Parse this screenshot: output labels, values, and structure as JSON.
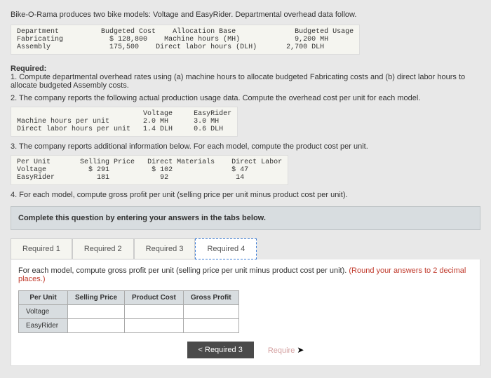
{
  "intro": "Bike-O-Rama produces two bike models: Voltage and EasyRider. Departmental overhead data follow.",
  "table1": {
    "h1": "Department",
    "h2": "Budgeted Cost",
    "h3": "Allocation Base",
    "h4": "Budgeted Usage",
    "r1c1": "Fabricating",
    "r1c2": "$ 128,800",
    "r1c3": "Machine hours (MH)",
    "r1c4": "9,200 MH",
    "r2c1": "Assembly",
    "r2c2": "175,500",
    "r2c3": "Direct labor hours (DLH)",
    "r2c4": "2,700 DLH"
  },
  "required_label": "Required:",
  "req1": "1. Compute departmental overhead rates using (a) machine hours to allocate budgeted Fabricating costs and (b) direct labor hours to allocate budgeted Assembly costs.",
  "req2": "2. The company reports the following actual production usage data. Compute the overhead cost per unit for each model.",
  "table2": {
    "h1": "",
    "h2": "Voltage",
    "h3": "EasyRider",
    "r1c1": "Machine hours per unit",
    "r1c2": "2.0 MH",
    "r1c3": "3.0 MH",
    "r2c1": "Direct labor hours per unit",
    "r2c2": "1.4 DLH",
    "r2c3": "0.6 DLH"
  },
  "req3": "3. The company reports additional information below. For each model, compute the product cost per unit.",
  "table3": {
    "h1": "Per Unit",
    "h2": "Selling Price",
    "h3": "Direct Materials",
    "h4": "Direct Labor",
    "r1c1": "Voltage",
    "r1c2": "$ 291",
    "r1c3": "$ 102",
    "r1c4": "$ 47",
    "r2c1": "EasyRider",
    "r2c2": "181",
    "r2c3": "92",
    "r2c4": "14"
  },
  "req4": "4. For each model, compute gross profit per unit (selling price per unit minus product cost per unit).",
  "instruction": "Complete this question by entering your answers in the tabs below.",
  "tabs": {
    "t1": "Required 1",
    "t2": "Required 2",
    "t3": "Required 3",
    "t4": "Required 4"
  },
  "tab4": {
    "instruction_main": "For each model, compute gross profit per unit (selling price per unit minus product cost per unit). ",
    "instruction_red": "(Round your answers to 2 decimal places.)",
    "headers": {
      "h1": "Per Unit",
      "h2": "Selling Price",
      "h3": "Product Cost",
      "h4": "Gross Profit"
    },
    "rows": {
      "r1": "Voltage",
      "r2": "EasyRider"
    }
  },
  "nav": {
    "prev": "<  Required 3",
    "next_placeholder": "Require"
  }
}
